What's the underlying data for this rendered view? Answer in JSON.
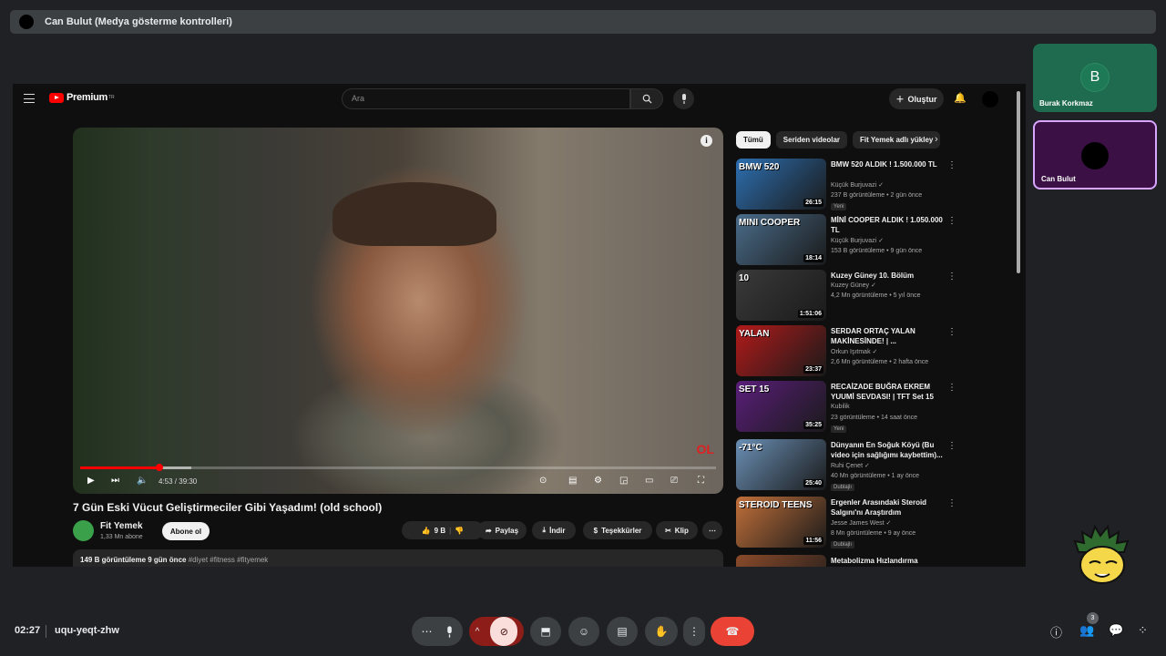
{
  "top_bar": {
    "title": "Can Bulut (Medya gösterme kontrolleri)"
  },
  "youtube": {
    "logo_text": "Premium",
    "logo_sup": "TR",
    "search_placeholder": "Ara",
    "create_label": "Oluştur",
    "video": {
      "time": "4:53 / 39:30",
      "progress_fraction": 0.124,
      "watermark": "OL",
      "title": "7 Gün Eski Vücut Geliştirmeciler Gibi Yaşadım! (old school)",
      "channel": "Fit Yemek",
      "subscribers": "1,33 Mn abone",
      "subscribe_label": "Abone ol",
      "likes": "9 B",
      "share_label": "Paylaş",
      "download_label": "İndir",
      "thanks_label": "Teşekkürler",
      "clip_label": "Klip",
      "desc_stats": "149 B görüntüleme  9 gün önce",
      "desc_tags": "#diyet #fitness #fityemek"
    },
    "chips": [
      "Tümü",
      "Seriden videolar",
      "Fit Yemek adlı yükley"
    ],
    "recommendations": [
      {
        "title": "BMW 520 ALDIK ! 1.500.000 TL",
        "channel": "Küçük Burjuvazi ✓",
        "meta": "237 B görüntüleme • 2 gün önce",
        "badge": "Yeni",
        "duration": "26:15",
        "thumb_label": "BMW 520",
        "color": "#2d6fb0"
      },
      {
        "title": "MİNİ COOPER ALDIK ! 1.050.000 TL",
        "channel": "Küçük Burjuvazi ✓",
        "meta": "153 B görüntüleme • 9 gün önce",
        "badge": "",
        "duration": "18:14",
        "thumb_label": "MINI COOPER",
        "color": "#4a6c8a"
      },
      {
        "title": "Kuzey Güney 10. Bölüm",
        "channel": "Kuzey Güney ✓",
        "meta": "4,2 Mn görüntüleme • 5 yıl önce",
        "badge": "",
        "duration": "1:51:06",
        "thumb_label": "10",
        "color": "#3a3a3a"
      },
      {
        "title": "SERDAR ORTAÇ YALAN MAKİNESİNDE! | ...",
        "channel": "Orkun Işıtmak ✓",
        "meta": "2,6 Mn görüntüleme • 2 hafta önce",
        "badge": "",
        "duration": "23:37",
        "thumb_label": "YALAN",
        "color": "#b21a1a"
      },
      {
        "title": "RECAİZADE BUĞRA EKREM YUUMİ SEVDASI! | TFT Set 15",
        "channel": "Kubilik",
        "meta": "23 görüntüleme • 14 saat önce",
        "badge": "Yeni",
        "duration": "35:25",
        "thumb_label": "SET 15",
        "color": "#5a1e7a"
      },
      {
        "title": "Dünyanın En Soğuk Köyü (Bu video için sağlığımı kaybettim)...",
        "channel": "Ruhi Çenet ✓",
        "meta": "40 Mn görüntüleme • 1 ay önce",
        "badge": "Dublajlı",
        "duration": "25:40",
        "thumb_label": "-71°C",
        "color": "#6a8fb5"
      },
      {
        "title": "Ergenler Arasındaki Steroid Salgını'nı Araştırdım",
        "channel": "Jesse James West ✓",
        "meta": "8 Mn görüntüleme • 9 ay önce",
        "badge": "Dublajlı",
        "duration": "11:56",
        "thumb_label": "STEROID TEENS",
        "color": "#c2703a"
      },
      {
        "title": "Metabolizma Hızlandırma",
        "channel": "",
        "meta": "",
        "badge": "",
        "duration": "",
        "thumb_label": "",
        "color": "#8a4a2a"
      }
    ]
  },
  "participants": [
    {
      "name": "Burak Korkmaz",
      "initial": "B"
    },
    {
      "name": "Can Bulut",
      "initial": ""
    }
  ],
  "meeting": {
    "time": "02:27",
    "code": "uqu-yeqt-zhw",
    "people_count": "3"
  }
}
